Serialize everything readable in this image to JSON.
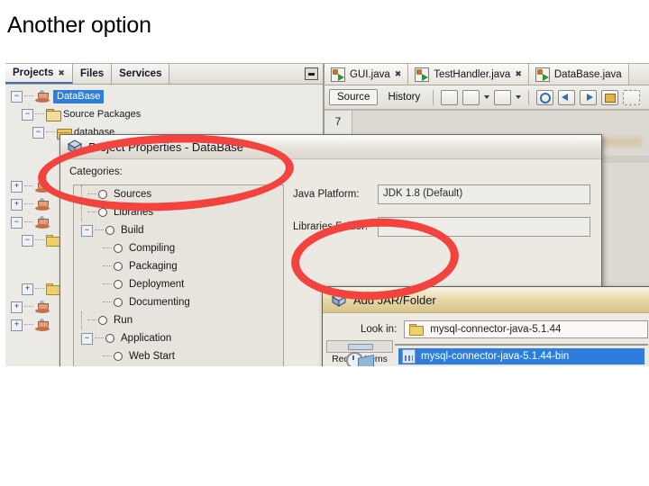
{
  "slide": {
    "title": "Another option"
  },
  "ide": {
    "panel_tabs": [
      {
        "label": "Projects",
        "close": "✖",
        "active": true
      },
      {
        "label": "Files",
        "active": false
      },
      {
        "label": "Services",
        "active": false
      }
    ],
    "minimize_tooltip": "Minimize Window",
    "project_tree": [
      {
        "label": "DataBase",
        "icon": "java-project-icon",
        "selected": true,
        "toggle": "−",
        "depth": 0
      },
      {
        "label": "Source Packages",
        "icon": "source-packages-icon",
        "selected": false,
        "toggle": "−",
        "depth": 1
      },
      {
        "label": "database",
        "icon": "package-icon",
        "selected": false,
        "toggle": "−",
        "depth": 2
      }
    ],
    "tree_partial": [
      {
        "icon": "java-project-icon",
        "toggle": "+"
      },
      {
        "icon": "java-project-icon",
        "toggle": "+"
      },
      {
        "icon": "java-project-icon",
        "toggle": "−"
      },
      {
        "icon": "package-icon",
        "toggle": "−"
      },
      {
        "icon": "package-icon",
        "toggle": "+"
      },
      {
        "icon": "java-project-icon",
        "toggle": "+"
      },
      {
        "icon": "java-project-icon",
        "toggle": "+"
      }
    ]
  },
  "properties_dialog": {
    "title": "Project Properties - DataBase",
    "icon": "cube-icon",
    "categories_label": "Categories:",
    "categories": [
      {
        "label": "Sources",
        "depth": 0,
        "toggle": ""
      },
      {
        "label": "Libraries",
        "depth": 0,
        "toggle": ""
      },
      {
        "label": "Build",
        "depth": 0,
        "toggle": "−"
      },
      {
        "label": "Compiling",
        "depth": 1,
        "toggle": ""
      },
      {
        "label": "Packaging",
        "depth": 1,
        "toggle": ""
      },
      {
        "label": "Deployment",
        "depth": 1,
        "toggle": ""
      },
      {
        "label": "Documenting",
        "depth": 1,
        "toggle": ""
      },
      {
        "label": "Run",
        "depth": 0,
        "toggle": ""
      },
      {
        "label": "Application",
        "depth": 0,
        "toggle": "−"
      },
      {
        "label": "Web Start",
        "depth": 1,
        "toggle": ""
      }
    ],
    "java_platform_label": "Java Platform:",
    "java_platform_value": "JDK 1.8 (Default)",
    "libraries_folder_label": "Libraries Folder:",
    "libraries_folder_value": ""
  },
  "jar_dialog": {
    "title": "Add JAR/Folder",
    "icon": "cube-icon",
    "look_in_label": "Look in:",
    "look_in_value": "mysql-connector-java-5.1.44",
    "places": [
      {
        "label": "Recent Items",
        "icon": "recent-items-icon"
      }
    ],
    "files": [
      {
        "label": "mysql-connector-java-5.1.44-bin",
        "icon": "jar-file-icon",
        "selected": true
      }
    ]
  },
  "editor": {
    "tabs": [
      {
        "label": "GUI.java",
        "close": "✖"
      },
      {
        "label": "TestHandler.java",
        "close": "✖"
      },
      {
        "label": "DataBase.java",
        "close": ""
      }
    ],
    "toolbar": {
      "source_label": "Source",
      "history_label": "History",
      "icons": [
        "last-edit-icon",
        "back-dropdown-icon",
        "forward-dropdown-icon",
        "find-selection-icon",
        "previous-bookmark-icon",
        "next-bookmark-icon",
        "toggle-rectangular-selection-icon",
        "shift-line-icon"
      ]
    },
    "line_number": "7"
  },
  "annotations": {
    "color": "#f2433f",
    "circles": [
      {
        "target": "project-properties-title"
      },
      {
        "target": "add-jar-folder-title"
      }
    ]
  }
}
